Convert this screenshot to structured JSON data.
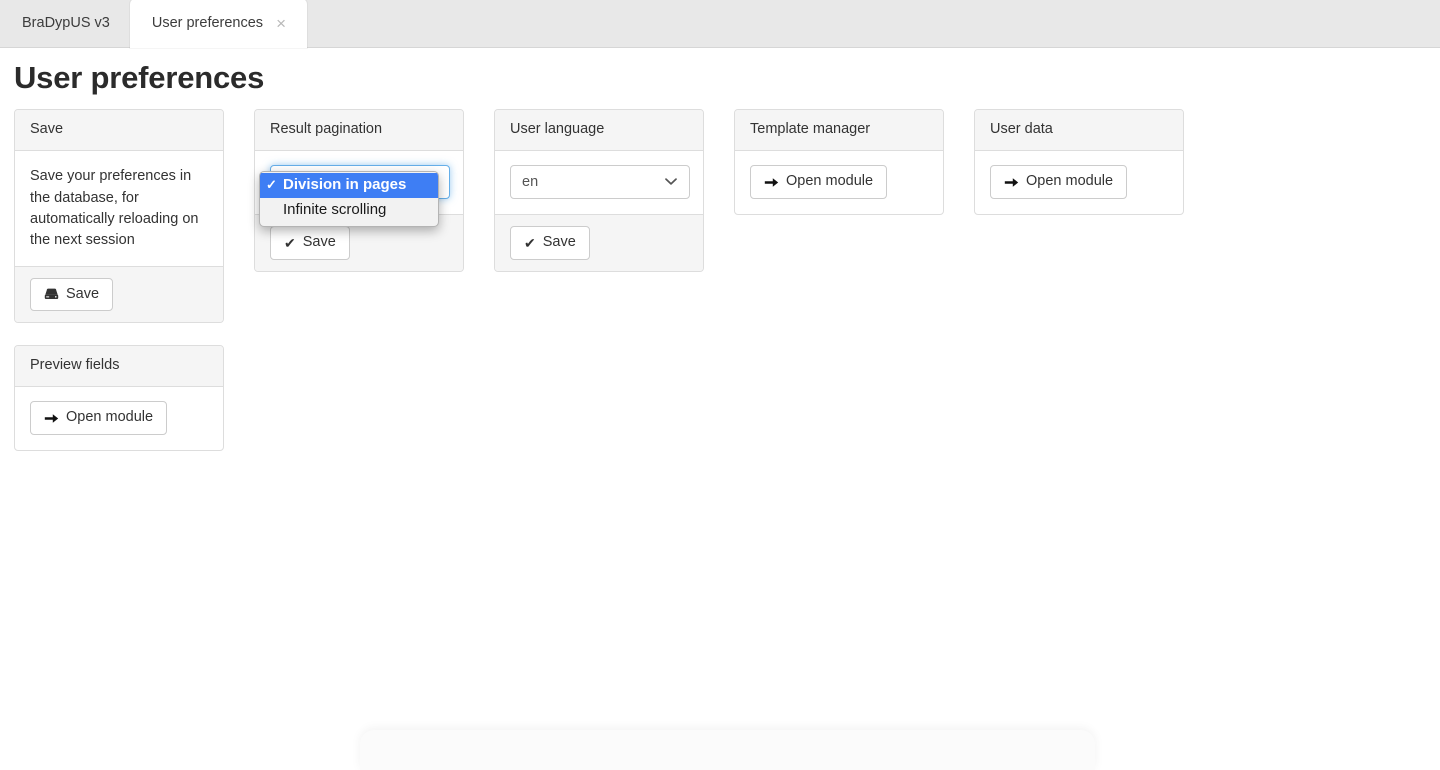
{
  "browser": {
    "brand_tab_label": "BraDypUS v3",
    "active_tab_label": "User preferences",
    "close_icon": "close-icon",
    "close_glyph": "×"
  },
  "page": {
    "title": "User preferences"
  },
  "panels": {
    "save": {
      "heading": "Save",
      "description": "Save your preferences in the database, for automatically reloading on the next session",
      "save_button": {
        "label": "Save",
        "icon": "hard-drive-save-icon"
      }
    },
    "preview_fields": {
      "heading": "Preview fields",
      "open_button": {
        "label": "Open module",
        "icon": "arrow-right-icon"
      }
    },
    "result_pagination": {
      "heading": "Result pagination",
      "select": {
        "name": "pagination-select",
        "value": "Division in pages",
        "expanded": true,
        "options": [
          {
            "label": "Division in pages",
            "selected": true
          },
          {
            "label": "Infinite scrolling",
            "selected": false
          }
        ]
      },
      "save_button": {
        "label": "Save",
        "icon": "check-icon"
      }
    },
    "user_language": {
      "heading": "User language",
      "select": {
        "name": "language-select",
        "value": "en",
        "expanded": false,
        "options": [
          {
            "label": "en",
            "selected": true
          }
        ]
      },
      "save_button": {
        "label": "Save",
        "icon": "check-icon"
      }
    },
    "template_manager": {
      "heading": "Template manager",
      "open_button": {
        "label": "Open module",
        "icon": "arrow-right-icon"
      }
    },
    "user_data": {
      "heading": "User data",
      "open_button": {
        "label": "Open module",
        "icon": "arrow-right-icon"
      }
    }
  },
  "colors": {
    "tabbar_bg": "#e8e8e8",
    "panel_border": "#dddddd",
    "panel_heading_bg": "#f5f5f5",
    "dropdown_highlight": "#3e7ef4",
    "focus_ring": "#66afe9",
    "text": "#333333"
  },
  "glyphs": {
    "check": "✔",
    "arrow_right": "➡",
    "tick_small": "✓"
  }
}
